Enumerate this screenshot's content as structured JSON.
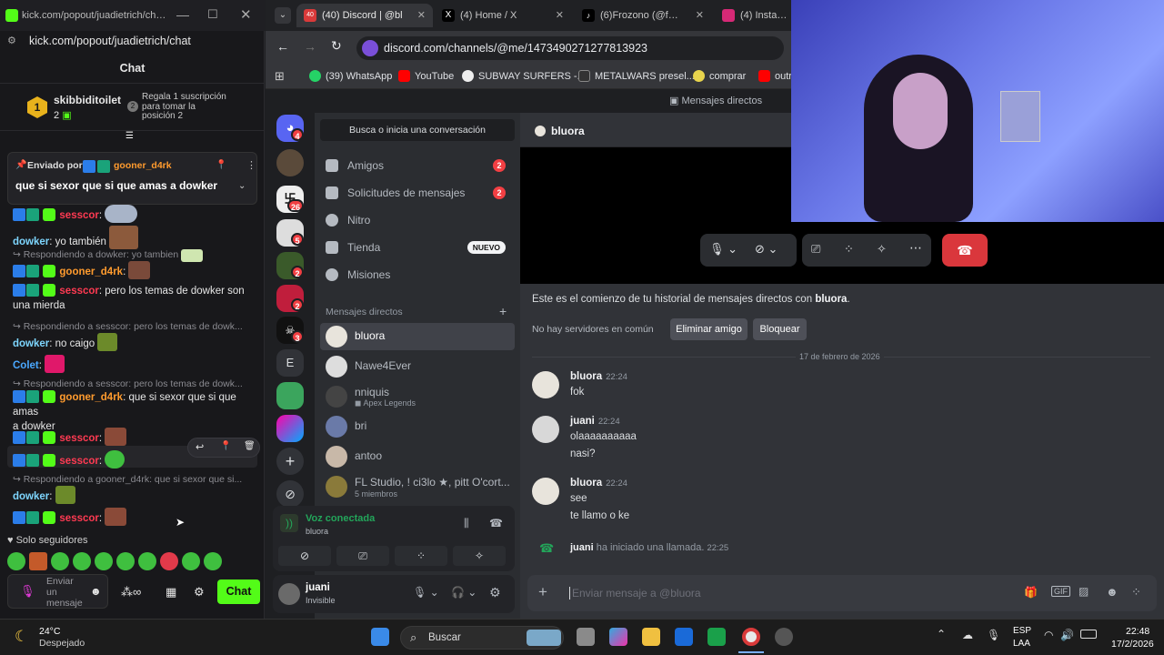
{
  "kick": {
    "url": "kick.com/popout/juadietrich/chat",
    "window_url": "kick.com/popout/juadietrich/chat...",
    "header": "Chat",
    "top_gifter": {
      "rank": "1",
      "name": "skibbiditoilet",
      "count": "2",
      "tip_rank": "2",
      "tip": "Regala 1 suscripción",
      "tip2": "para tomar la",
      "tip3": "posición 2"
    },
    "pinned": {
      "prefix": "Enviado por",
      "user": "gooner_d4rk",
      "text": "que si sexor que si que amas a dowker"
    },
    "messages": [
      {
        "user": "sesscor",
        "text": ":"
      },
      {
        "user": "dowker",
        "text": ": yo también"
      },
      {
        "reply": "Respondiendo a dowker: yo tambien"
      },
      {
        "user": "gooner_d4rk",
        "text": ":"
      },
      {
        "user": "sesscor",
        "text": ": pero los temas de dowker son",
        "text2": "una mierda"
      },
      {
        "reply": "Respondiendo a sesscor: pero los temas de dowk..."
      },
      {
        "user": "dowker",
        "text": ": no caigo"
      },
      {
        "user": "Colet",
        "text": ":"
      },
      {
        "reply": "Respondiendo a sesscor: pero los temas de dowk..."
      },
      {
        "user": "gooner_d4rk",
        "text": ": que si sexor que si que amas",
        "text2": "a dowker"
      },
      {
        "user": "sesscor",
        "text": ":"
      },
      {
        "user": "sesscor",
        "text": ":"
      },
      {
        "reply": "Respondiendo a gooner_d4rk: que si sexor que si..."
      },
      {
        "user": "dowker",
        "text": ":"
      },
      {
        "user": "sesscor",
        "text": ":"
      }
    ],
    "followers_only": "Solo seguidores",
    "input_placeholder": "Enviar un mensaje",
    "send": "Chat"
  },
  "chrome": {
    "tabs": [
      {
        "label": "(40) Discord | @bl"
      },
      {
        "label": "(4) Home / X"
      },
      {
        "label": "(6)Frozono (@frozon"
      },
      {
        "label": "(4) Instagram"
      }
    ],
    "url": "discord.com/channels/@me/1473490271277813923",
    "bookmarks": [
      "(39) WhatsApp",
      "YouTube",
      "SUBWAY SURFERS -...",
      "METALWARS presel...",
      "comprar",
      "outr"
    ]
  },
  "discord": {
    "topbar": "Mensajes directos",
    "search": "Busca o inicia una conversación",
    "guild_badges": [
      "4",
      "26",
      "5",
      "2",
      "2",
      "3"
    ],
    "guild_letter": "E",
    "menu": [
      {
        "label": "Amigos",
        "badge": "2"
      },
      {
        "label": "Solicitudes de mensajes",
        "badge": "2"
      },
      {
        "label": "Nitro"
      },
      {
        "label": "Tienda",
        "tag": "NUEVO"
      },
      {
        "label": "Misiones"
      }
    ],
    "dm_header": "Mensajes directos",
    "dms": [
      {
        "name": "bluora"
      },
      {
        "name": "Nawe4Ever"
      },
      {
        "name": "nniquis",
        "sub": "Apex Legends"
      },
      {
        "name": "bri"
      },
      {
        "name": "antoo"
      },
      {
        "name": "FL Studio, ! ci3lo ★, pitt O'cort...",
        "sub": "5 miembros"
      }
    ],
    "voice": {
      "status": "Voz conectada",
      "channel": "bluora"
    },
    "user": {
      "name": "juani",
      "status": "Invisible"
    },
    "channel": "bluora",
    "intro": "Este es el comienzo de tu historial de mensajes directos con ",
    "intro_name": "bluora",
    "no_servers": "No hay servidores en común",
    "remove_friend": "Eliminar amigo",
    "block": "Bloquear",
    "date": "17 de febrero de 2026",
    "messages": [
      {
        "author": "bluora",
        "time": "22:24",
        "lines": [
          "fok"
        ]
      },
      {
        "author": "juani",
        "time": "22:24",
        "lines": [
          "olaaaaaaaaaa",
          "nasi?"
        ]
      },
      {
        "author": "bluora",
        "time": "22:24",
        "lines": [
          "see",
          "te llamo o ke"
        ]
      }
    ],
    "call": {
      "author": "juani",
      "text": "ha iniciado una llamada.",
      "time": "22:25"
    },
    "composer": "Enviar mensaje a @bluora"
  },
  "taskbar": {
    "temp": "24°C",
    "weather": "Despejado",
    "search": "Buscar",
    "lang": "ESP",
    "lang2": "LAA",
    "time": "22:48",
    "date": "17/2/2026"
  }
}
